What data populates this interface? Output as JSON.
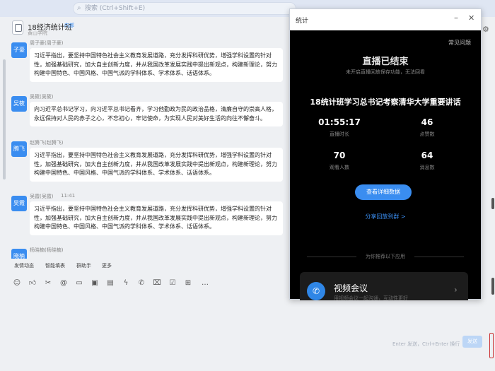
{
  "search": {
    "placeholder": "搜索 (Ctrl+Shift+E)"
  },
  "group": {
    "name": "18经济统计班",
    "tag": "内部",
    "sub": "黄山学院"
  },
  "messages": [
    {
      "avatar": "子豪",
      "sender": "周子豪(周子豪)",
      "text": "习近平指出，要坚持中国特色社会主义教育发展道路，充分发挥科研优势，增强学科设置的针对性，加强基础研究，加大自主创新力度，并从我国改革发展实践中提出新观点，构建新理论，努力构建中国特色、中国风格、中国气派的学科体系、学术体系、话语体系。"
    },
    {
      "avatar": "吴筱",
      "sender": "吴筱(吴筱)",
      "text": "向习近平总书记学习，向习近平总书记看齐，学习他勤政为民的政治品格，清廉自守的崇高人格，永远保持对人民的赤子之心，不忘初心，牢记使命，为实现人民对美好生活的向往不懈奋斗。"
    },
    {
      "avatar": "腾飞",
      "sender": "赵腾飞(赵腾飞)",
      "text": "习近平指出，要坚持中国特色社会主义教育发展道路，充分发挥科研优势，增强学科设置的针对性，加强基础研究，加大自主创新力度，并从我国改革发展实践中提出新观点，构建新理论，努力构建中国特色、中国风格、中国气派的学科体系、学术体系、话语体系。"
    },
    {
      "avatar": "吴霞",
      "sender": "吴霞(吴霞)",
      "time": "11:41",
      "text": "习近平指出，要坚持中国特色社会主义教育发展道路，充分发挥科研优势，增强学科设置的针对性，加强基础研究，加大自主创新力度，并从我国改革发展实践中提出新观点，构建新理论，努力构建中国特色、中国风格、中国气派的学科体系、学术体系、话语体系。"
    },
    {
      "avatar": "晓楠",
      "sender": "杨晓楠(杨晓楠)"
    }
  ],
  "toolbar_tabs": [
    "发情动态",
    "智能填表",
    "群助手",
    "更多"
  ],
  "input": {
    "hint": "Enter 发送，Ctrl+Enter 换行",
    "send": "发送"
  },
  "popup": {
    "title": "统计",
    "faq": "常见问题",
    "ended": "直播已结束",
    "ended_sub": "未开启直播回放保存功能，无法回看",
    "live_title": "18统计班学习总书记考察清华大学重要讲话",
    "stats": [
      {
        "value": "01:55:17",
        "label": "直播时长"
      },
      {
        "value": "46",
        "label": "点赞数"
      },
      {
        "value": "70",
        "label": "观看人数"
      },
      {
        "value": "64",
        "label": "消息数"
      }
    ],
    "detail_button": "查看详细数据",
    "share": "分享回放到群 >",
    "recommend": "为你推荐以下应用",
    "card_title": "视频会议",
    "card_sub": "用视频会议一起沟通，互动性更好"
  }
}
